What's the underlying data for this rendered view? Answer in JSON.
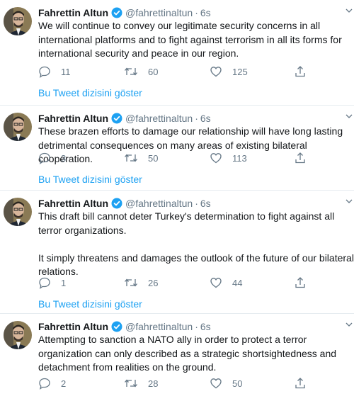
{
  "tweets": [
    {
      "name": "Fahrettin Altun",
      "handle": "@fahrettinaltun",
      "separator": "·",
      "time": "6s",
      "text": "We will continue to convey our legitimate security concerns in all international platforms and to fight against terrorism in all its forms for international security and peace in our region.",
      "replies": "11",
      "retweets": "60",
      "likes": "125",
      "show_thread": "Bu Tweet dizisini göster"
    },
    {
      "name": "Fahrettin Altun",
      "handle": "@fahrettinaltun",
      "separator": "·",
      "time": "6s",
      "text": "These brazen efforts to damage our relationship will have long lasting detrimental consequences on many areas of existing bilateral cooperation.",
      "replies": "3",
      "retweets": "50",
      "likes": "113",
      "show_thread": "Bu Tweet dizisini göster"
    },
    {
      "name": "Fahrettin Altun",
      "handle": "@fahrettinaltun",
      "separator": "·",
      "time": "6s",
      "text": "This draft bill cannot deter Turkey's determination to fight against all terror organizations.\n\nIt simply threatens and damages the outlook of the future of our bilateral relations.",
      "replies": "1",
      "retweets": "26",
      "likes": "44",
      "show_thread": "Bu Tweet dizisini göster"
    },
    {
      "name": "Fahrettin Altun",
      "handle": "@fahrettinaltun",
      "separator": "·",
      "time": "6s",
      "text": "Attempting to sanction a NATO ally in order to protect a terror organization can only described as a strategic shortsightedness and detachment from realities on the ground.",
      "replies": "2",
      "retweets": "28",
      "likes": "50"
    }
  ],
  "icons": {
    "verified": "verified-badge-icon",
    "reply": "reply-icon",
    "retweet": "retweet-icon",
    "like": "like-icon",
    "share": "share-icon",
    "more": "chevron-down-icon"
  },
  "colors": {
    "accent": "#1da1f2",
    "muted": "#657786",
    "text": "#14171a",
    "divider": "#e6ecf0"
  }
}
